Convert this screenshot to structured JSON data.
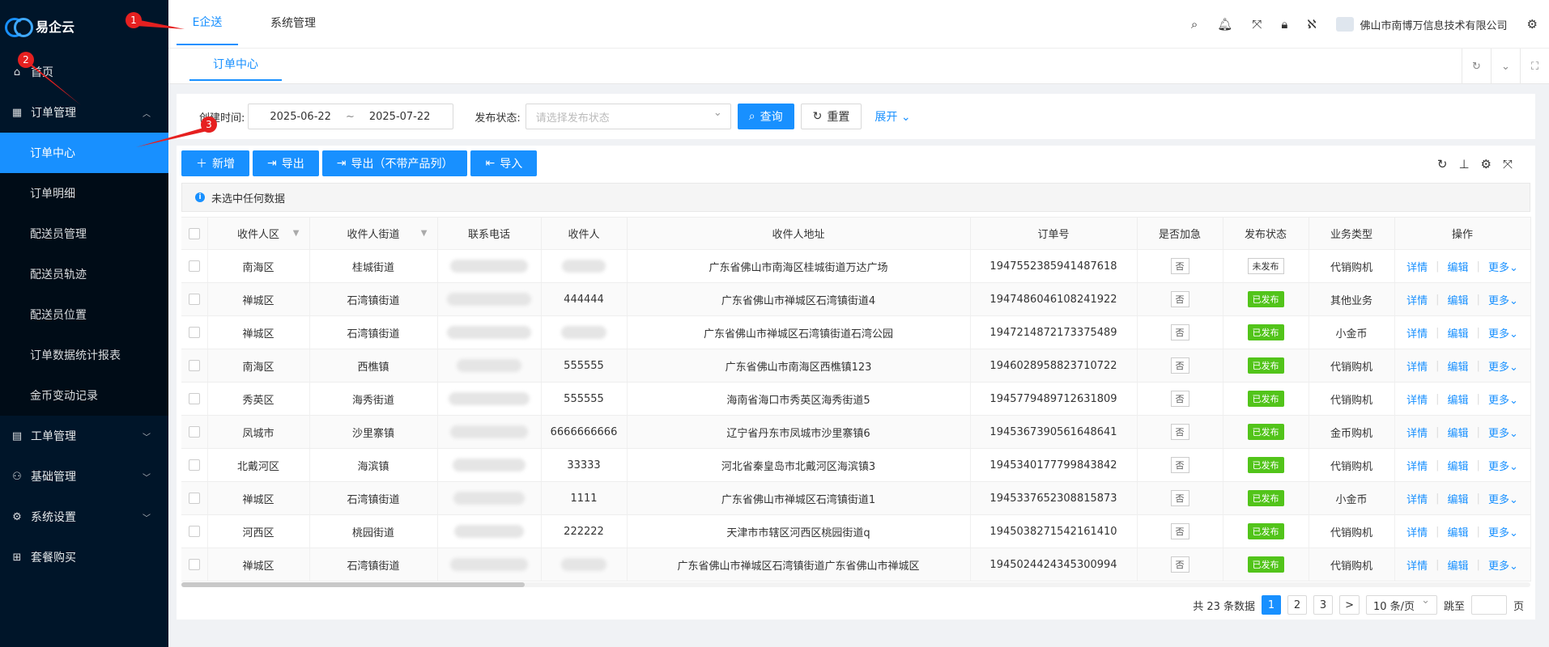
{
  "app": {
    "name": "易企云"
  },
  "sidebar": {
    "items": [
      {
        "label": "首页",
        "icon": "home-icon"
      },
      {
        "label": "订单管理",
        "icon": "grid-icon",
        "expanded": true
      },
      {
        "label": "订单中心",
        "active": true
      },
      {
        "label": "订单明细"
      },
      {
        "label": "配送员管理"
      },
      {
        "label": "配送员轨迹"
      },
      {
        "label": "配送员位置"
      },
      {
        "label": "订单数据统计报表"
      },
      {
        "label": "金币变动记录"
      },
      {
        "label": "工单管理",
        "icon": "ticket-icon"
      },
      {
        "label": "基础管理",
        "icon": "people-icon"
      },
      {
        "label": "系统设置",
        "icon": "gear-icon"
      },
      {
        "label": "套餐购买",
        "icon": "gift-icon"
      }
    ]
  },
  "header": {
    "tabs": [
      "E企送",
      "系统管理"
    ],
    "company": "佛山市南博万信息技术有限公司"
  },
  "page_tabs": [
    "订单中心"
  ],
  "filter": {
    "date_label": "创建时间:",
    "date_start": "2025-06-22",
    "date_sep": "~",
    "date_end": "2025-07-22",
    "status_label": "发布状态:",
    "status_placeholder": "请选择发布状态",
    "search_button": "查询",
    "reset_button": "重置",
    "expand_link": "展开"
  },
  "toolbar": {
    "add": "新增",
    "export": "导出",
    "export_no_product": "导出（不带产品列）",
    "import": "导入"
  },
  "alert": "未选中任何数据",
  "table": {
    "columns": [
      "收件人区",
      "收件人街道",
      "联系电话",
      "收件人",
      "收件人地址",
      "订单号",
      "是否加急",
      "发布状态",
      "业务类型",
      "操作"
    ],
    "rows": [
      {
        "district": "南海区",
        "street": "桂城街道",
        "recipient": "",
        "address": "广东省佛山市南海区桂城街道万达广场",
        "order_no": "1947552385941487618",
        "urgent": "否",
        "status": "未发布",
        "type": "代销购机"
      },
      {
        "district": "禅城区",
        "street": "石湾镇街道",
        "recipient": "444444",
        "address": "广东省佛山市禅城区石湾镇街道4",
        "order_no": "1947486046108241922",
        "urgent": "否",
        "status": "已发布",
        "type": "其他业务"
      },
      {
        "district": "禅城区",
        "street": "石湾镇街道",
        "recipient": "",
        "address": "广东省佛山市禅城区石湾镇街道石湾公园",
        "order_no": "1947214872173375489",
        "urgent": "否",
        "status": "已发布",
        "type": "小金币"
      },
      {
        "district": "南海区",
        "street": "西樵镇",
        "recipient": "555555",
        "address": "广东省佛山市南海区西樵镇123",
        "order_no": "1946028958823710722",
        "urgent": "否",
        "status": "已发布",
        "type": "代销购机"
      },
      {
        "district": "秀英区",
        "street": "海秀街道",
        "recipient": "555555",
        "address": "海南省海口市秀英区海秀街道5",
        "order_no": "1945779489712631809",
        "urgent": "否",
        "status": "已发布",
        "type": "代销购机"
      },
      {
        "district": "凤城市",
        "street": "沙里寨镇",
        "recipient": "6666666666",
        "address": "辽宁省丹东市凤城市沙里寨镇6",
        "order_no": "1945367390561648641",
        "urgent": "否",
        "status": "已发布",
        "type": "金币购机"
      },
      {
        "district": "北戴河区",
        "street": "海滨镇",
        "recipient": "33333",
        "address": "河北省秦皇岛市北戴河区海滨镇3",
        "order_no": "1945340177799843842",
        "urgent": "否",
        "status": "已发布",
        "type": "代销购机"
      },
      {
        "district": "禅城区",
        "street": "石湾镇街道",
        "recipient": "1111",
        "address": "广东省佛山市禅城区石湾镇街道1",
        "order_no": "1945337652308815873",
        "urgent": "否",
        "status": "已发布",
        "type": "小金币"
      },
      {
        "district": "河西区",
        "street": "桃园街道",
        "recipient": "222222",
        "address": "天津市市辖区河西区桃园街道q",
        "order_no": "1945038271542161410",
        "urgent": "否",
        "status": "已发布",
        "type": "代销购机"
      },
      {
        "district": "禅城区",
        "street": "石湾镇街道",
        "recipient": "",
        "address": "广东省佛山市禅城区石湾镇街道广东省佛山市禅城区",
        "order_no": "1945024424345300994",
        "urgent": "否",
        "status": "已发布",
        "type": "代销购机"
      }
    ],
    "actions": {
      "detail": "详情",
      "edit": "编辑",
      "more": "更多"
    }
  },
  "pagination": {
    "total": "共 23 条数据",
    "pages": [
      "1",
      "2",
      "3"
    ],
    "next": ">",
    "page_size": "10 条/页",
    "jump_label": "跳至",
    "jump_suffix": "页"
  },
  "annotations": [
    "1",
    "2",
    "3"
  ],
  "colors": {
    "primary": "#1890ff",
    "sidebar": "#001529",
    "success": "#52c41a",
    "annotation": "#e62020"
  }
}
